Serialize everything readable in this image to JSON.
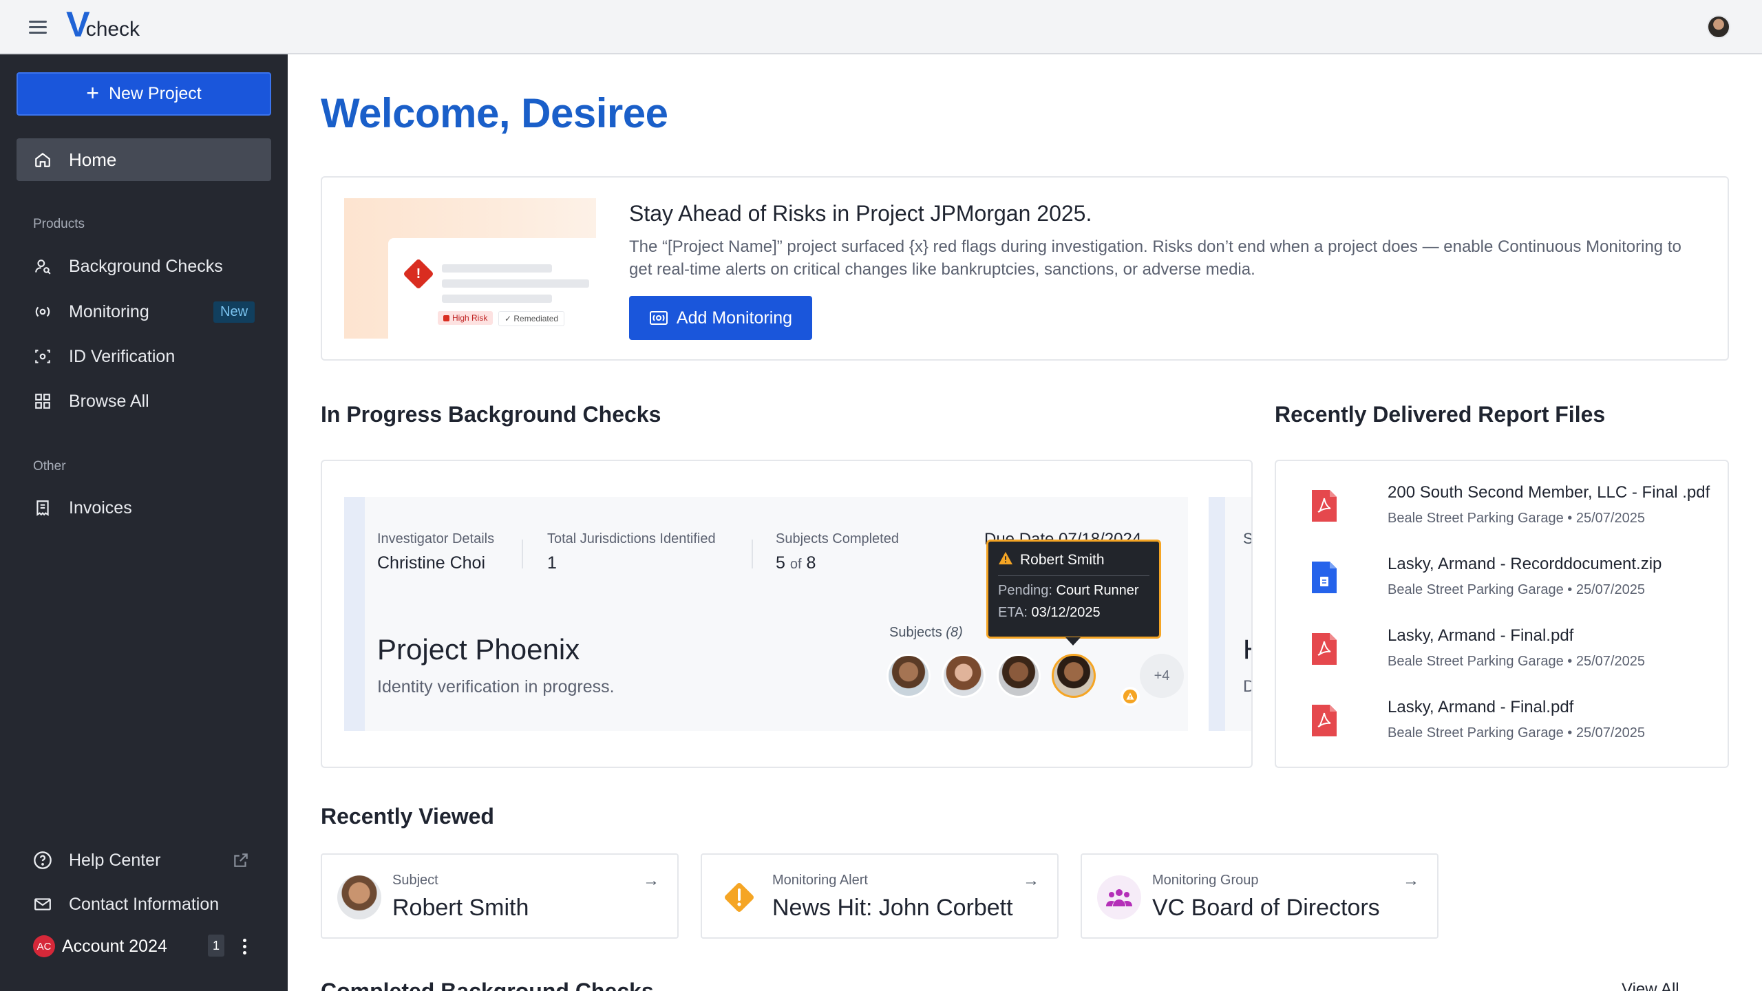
{
  "app": {
    "logo_v": "V",
    "logo_text": "check"
  },
  "sidebar": {
    "new_project_label": "New Project",
    "home_label": "Home",
    "products_label": "Products",
    "products": [
      {
        "label": "Background Checks",
        "icon": "user-search-icon"
      },
      {
        "label": "Monitoring",
        "icon": "monitoring-icon",
        "badge": "New"
      },
      {
        "label": "ID Verification",
        "icon": "id-scan-icon"
      },
      {
        "label": "Browse All",
        "icon": "grid-icon"
      }
    ],
    "other_label": "Other",
    "invoices_label": "Invoices",
    "help_center_label": "Help Center",
    "contact_label": "Contact Information",
    "account": {
      "initials": "AC",
      "label": "Account 2024",
      "count": "1"
    }
  },
  "main": {
    "welcome": "Welcome, Desiree",
    "promo": {
      "title": "Stay Ahead of Risks in Project JPMorgan 2025.",
      "body": "The “[Project Name]” project surfaced {x} red flags during investigation. Risks don’t end when a project does — enable Continuous Monitoring to get real-time alerts on critical changes like bankruptcies, sanctions, or adverse media.",
      "button": "Add Monitoring",
      "illus_high_risk": "High Risk",
      "illus_remediated": "Remediated"
    },
    "in_progress": {
      "title": "In Progress Background Checks",
      "investigator_label": "Investigator Details",
      "investigator_value": "Christine Choi",
      "jurisdictions_label": "Total Jurisdictions Identified",
      "jurisdictions_value": "1",
      "subjects_completed_label": "Subjects Completed",
      "subjects_done": "5",
      "subjects_of": "of",
      "subjects_total": "8",
      "due_date": "Due Date 07/18/2024",
      "project_name": "Project Phoenix",
      "project_status": "Identity verification in progress.",
      "subjects_label": "Subjects",
      "subjects_count": "(8)",
      "more_subjects": "+4",
      "peek_label": "S",
      "peek_title": "H",
      "peek_sub": "D",
      "tooltip": {
        "name": "Robert Smith",
        "pending_label": "Pending:",
        "pending_value": "Court Runner",
        "eta_label": "ETA:",
        "eta_value": "03/12/2025"
      }
    },
    "recent_files": {
      "title": "Recently Delivered Report Files",
      "files": [
        {
          "name": "200 South Second Member, LLC - Final .pdf",
          "project": "Beale Street Parking Garage",
          "date": "25/07/2025",
          "icon": "pdf-icon"
        },
        {
          "name": "Lasky, Armand - Recorddocument.zip",
          "project": "Beale Street Parking Garage",
          "date": "25/07/2025",
          "icon": "doc-icon"
        },
        {
          "name": "Lasky, Armand - Final.pdf",
          "project": "Beale Street Parking Garage",
          "date": "25/07/2025",
          "icon": "pdf-icon"
        },
        {
          "name": "Lasky, Armand - Final.pdf",
          "project": "Beale Street Parking Garage",
          "date": "25/07/2025",
          "icon": "pdf-icon"
        }
      ],
      "separator": "•"
    },
    "recently_viewed": {
      "title": "Recently Viewed",
      "items": [
        {
          "type": "Subject",
          "name": "Robert Smith"
        },
        {
          "type": "Monitoring Alert",
          "name": "News Hit: John Corbett"
        },
        {
          "type": "Monitoring Group",
          "name": "VC Board of Directors"
        }
      ]
    },
    "completed": {
      "title": "Completed Background Checks",
      "view_all": "View All"
    }
  },
  "colors": {
    "brand": "#1a56db",
    "sidebar_bg": "#252830",
    "welcome": "#1a5fc9",
    "warning": "#f5a524",
    "pdf_red": "#e5484d",
    "doc_blue": "#2563eb"
  }
}
